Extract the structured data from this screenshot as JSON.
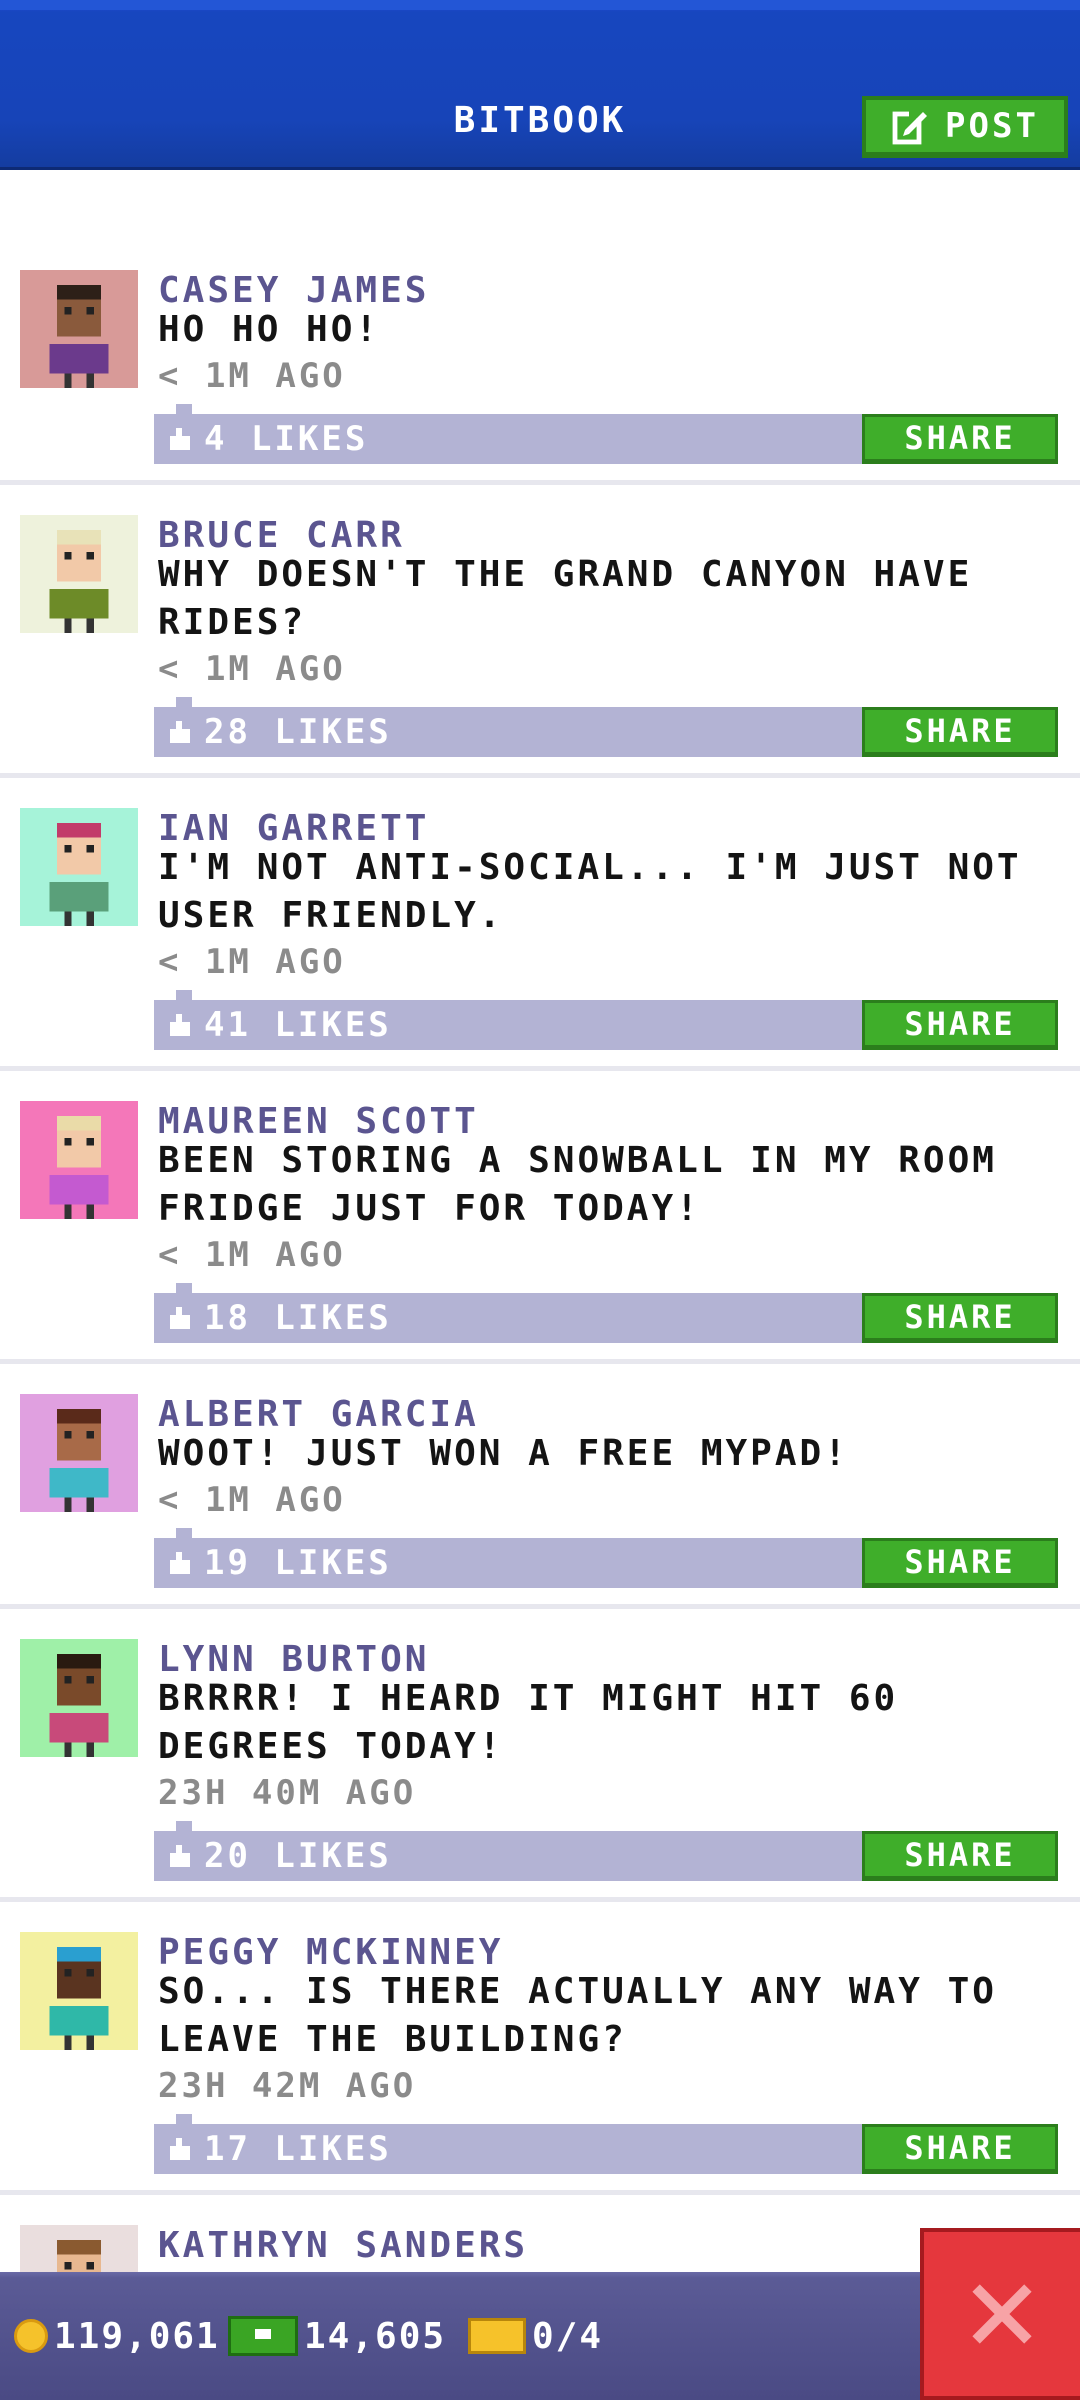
{
  "header": {
    "title": "BITBOOK",
    "post_label": "POST"
  },
  "posts": [
    {
      "name": "CASEY JAMES",
      "message": "HO HO HO!",
      "time": "< 1M AGO",
      "likes": "4 LIKES",
      "share": "SHARE",
      "avatar": {
        "bg": "#d89a98",
        "skin": "#8a5a3c",
        "hair": "#2d2018",
        "shirt": "#6b3a8c"
      }
    },
    {
      "name": "BRUCE CARR",
      "message": "WHY DOESN'T THE GRAND CANYON HAVE RIDES?",
      "time": "< 1M AGO",
      "likes": "28 LIKES",
      "share": "SHARE",
      "avatar": {
        "bg": "#eef2dc",
        "skin": "#f2c9a8",
        "hair": "#e8e2b8",
        "shirt": "#6d8b28"
      }
    },
    {
      "name": "IAN GARRETT",
      "message": "I'M NOT ANTI-SOCIAL... I'M JUST NOT USER FRIENDLY.",
      "time": "< 1M AGO",
      "likes": "41 LIKES",
      "share": "SHARE",
      "avatar": {
        "bg": "#a6f3d9",
        "skin": "#f2c9a8",
        "hair": "#c23b6a",
        "shirt": "#5aa07a"
      }
    },
    {
      "name": "MAUREEN SCOTT",
      "message": "BEEN STORING A SNOWBALL IN MY ROOM FRIDGE JUST FOR TODAY!",
      "time": "< 1M AGO",
      "likes": "18 LIKES",
      "share": "SHARE",
      "avatar": {
        "bg": "#f477b9",
        "skin": "#f2c9a8",
        "hair": "#eadba8",
        "shirt": "#c45ad0"
      }
    },
    {
      "name": "ALBERT GARCIA",
      "message": "WOOT! JUST WON A FREE MYPAD!",
      "time": "< 1M AGO",
      "likes": "19 LIKES",
      "share": "SHARE",
      "avatar": {
        "bg": "#e0a0e0",
        "skin": "#a86a48",
        "hair": "#5a2a1a",
        "shirt": "#3fb8c8"
      }
    },
    {
      "name": "LYNN BURTON",
      "message": "BRRRR! I HEARD IT MIGHT HIT 60 DEGREES TODAY!",
      "time": "23H 40M AGO",
      "likes": "20 LIKES",
      "share": "SHARE",
      "avatar": {
        "bg": "#9ff0a8",
        "skin": "#7a4a2a",
        "hair": "#2a1a10",
        "shirt": "#c84a7a"
      }
    },
    {
      "name": "PEGGY MCKINNEY",
      "message": "SO... IS THERE ACTUALLY ANY WAY TO LEAVE THE BUILDING?",
      "time": "23H 42M AGO",
      "likes": "17 LIKES",
      "share": "SHARE",
      "avatar": {
        "bg": "#f3f0a0",
        "skin": "#5a3420",
        "hair": "#2a9fd0",
        "shirt": "#2fb8a8"
      }
    },
    {
      "name": "KATHRYN SANDERS",
      "message": "",
      "time": "",
      "likes": "",
      "share": "",
      "avatar": {
        "bg": "#eadede",
        "skin": "#e8b890",
        "hair": "#8a5a30",
        "shirt": "#9a4a6a"
      }
    }
  ],
  "bottom_bar": {
    "coins": "119,061",
    "bux": "14,605",
    "tickets": "0/4"
  },
  "colors": {
    "header_blue": "#1744b8",
    "accent_green": "#3fae2a",
    "likes_bar": "#b3b3d4",
    "name_purple": "#5b5590",
    "close_red": "#e5373d"
  },
  "icons": [
    "edit-icon",
    "like-icon",
    "coin-icon",
    "bux-icon",
    "ticket-icon",
    "close-icon"
  ]
}
